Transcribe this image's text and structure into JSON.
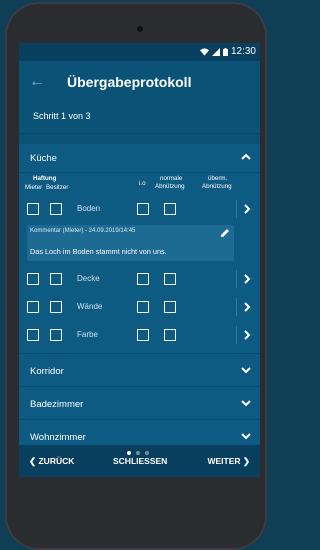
{
  "status": {
    "time": "12:30",
    "wifi_icon": "wifi-icon",
    "signal_icon": "signal-icon",
    "battery_icon": "battery-icon"
  },
  "appbar": {
    "title": "Übergabeprotokoll",
    "back_icon": "back-arrow-icon"
  },
  "step": "Schritt 1 von 3",
  "kueche": {
    "title": "Küche",
    "expanded": true,
    "headers": {
      "haftung": "Haftung",
      "mieter": "Mieter",
      "besitzer": "Besitzer",
      "io": "i.o",
      "normale_1": "normale",
      "normale_2": "Abnützung",
      "uberm_1": "überm.",
      "uberm_2": "Abnützung"
    },
    "rows": [
      {
        "label": "Boden"
      },
      {
        "label": "Decke"
      },
      {
        "label": "Wände"
      },
      {
        "label": "Farbe"
      }
    ],
    "comment": {
      "meta": "Kommentar (Mieter) - 24.09.2019/14:45",
      "text": "Das Loch im Boden stammt nicht von uns."
    }
  },
  "sections": [
    {
      "title": "Korridor"
    },
    {
      "title": "Badezimmer"
    },
    {
      "title": "Wohnzimmer"
    }
  ],
  "pager": {
    "total": 3,
    "active": 1
  },
  "bottom": {
    "back": "ZURÜCK",
    "close": "SCHLIESSEN",
    "next": "WEITER"
  },
  "colors": {
    "accent": "#0b5277",
    "section": "#0d5a82",
    "bar": "#083f5e"
  }
}
